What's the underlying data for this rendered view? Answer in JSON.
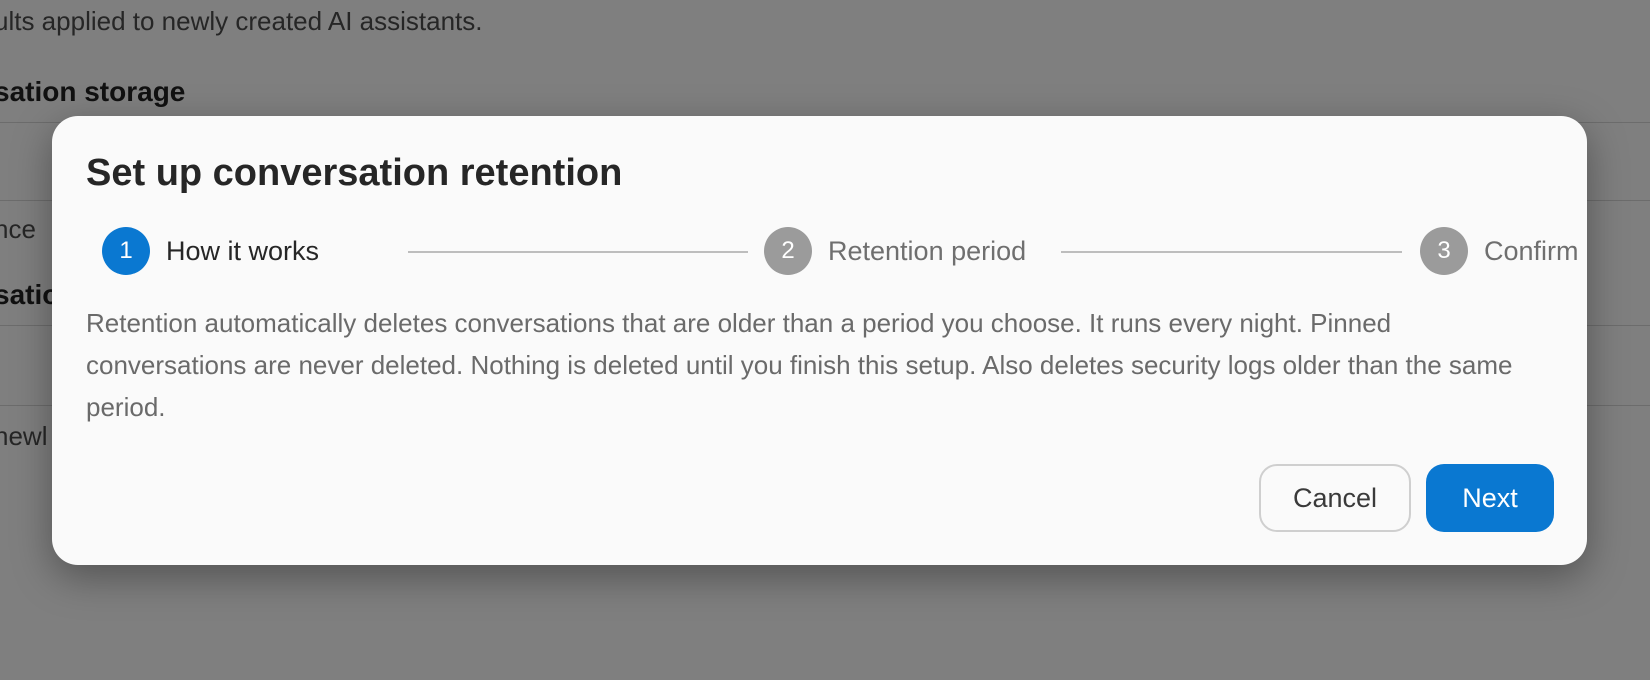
{
  "background": {
    "description": "ults applied to newly created AI assistants.",
    "section_heading": "sation storage",
    "partial_text_1": "nce",
    "section_heading_2": "satio",
    "partial_text_2": "newl"
  },
  "dialog": {
    "title": "Set up conversation retention",
    "steps": [
      {
        "number": "1",
        "label": "How it works",
        "state": "active"
      },
      {
        "number": "2",
        "label": "Retention period",
        "state": "inactive"
      },
      {
        "number": "3",
        "label": "Confirm",
        "state": "inactive"
      }
    ],
    "body": "Retention automatically deletes conversations that are older than a period you choose. It runs every night. Pinned conversations are never deleted. Nothing is deleted until you finish this setup. Also deletes security logs older than the same period.",
    "cancel_label": "Cancel",
    "next_label": "Next"
  },
  "colors": {
    "accent": "#0a78d1",
    "inactive_step": "#9b9b9b",
    "overlay": "rgba(0,0,0,0.48)"
  }
}
